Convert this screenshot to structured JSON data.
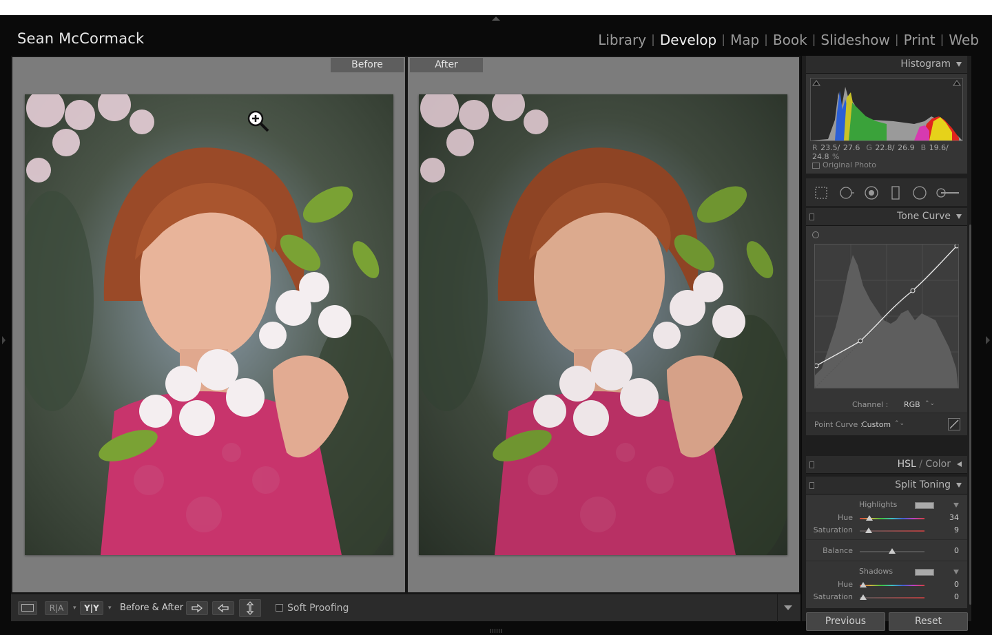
{
  "header": {
    "identity_plate": "Sean McCormack",
    "modules": [
      {
        "label": "Library",
        "active": false
      },
      {
        "label": "Develop",
        "active": true
      },
      {
        "label": "Map",
        "active": false
      },
      {
        "label": "Book",
        "active": false
      },
      {
        "label": "Slideshow",
        "active": false
      },
      {
        "label": "Print",
        "active": false
      },
      {
        "label": "Web",
        "active": false
      }
    ],
    "separator": "|"
  },
  "viewer": {
    "before_label": "Before",
    "after_label": "After",
    "photo_subject": "portrait-red-haired-woman-cherry-blossoms",
    "zoom_cursor_icon": "zoom-in-icon"
  },
  "toolbar": {
    "ra_label": "R|A",
    "yy_label": "Y|Y",
    "caret": "▾",
    "before_after_label": "Before & After :",
    "soft_proofing_label": "Soft Proofing",
    "soft_proofing_checked": false
  },
  "panel": {
    "histogram": {
      "title": "Histogram",
      "readout": {
        "r_label": "R",
        "r_value": "23.5/ 27.6",
        "g_label": "G",
        "g_value": "22.8/ 26.9",
        "b_label": "B",
        "b_value": "19.6/ 24.8",
        "unit": "%"
      },
      "original_photo_label": "Original Photo"
    },
    "tools": [
      "crop-overlay-icon",
      "spot-removal-icon",
      "red-eye-icon",
      "graduated-filter-icon",
      "radial-filter-icon",
      "adjustment-brush-icon"
    ],
    "tone_curve": {
      "title": "Tone Curve",
      "channel_label": "Channel :",
      "channel_value": "RGB",
      "point_curve_label": "Point Curve :",
      "point_curve_value": "Custom",
      "spinner": "⌃⌄"
    },
    "hsl": {
      "title_main": "HSL",
      "title_sep": " / ",
      "title_second": "Color"
    },
    "split_toning": {
      "title": "Split Toning",
      "highlights_label": "Highlights",
      "highlights_hue_label": "Hue",
      "highlights_hue": 34,
      "highlights_saturation_label": "Saturation",
      "highlights_saturation": 9,
      "balance_label": "Balance",
      "balance": 0,
      "shadows_label": "Shadows",
      "shadows_hue_label": "Hue",
      "shadows_hue": 0,
      "shadows_saturation_label": "Saturation",
      "shadows_saturation": 0
    },
    "buttons": {
      "previous": "Previous",
      "reset": "Reset"
    }
  },
  "colors": {
    "background": "#0a0a0a",
    "pane_gray": "#7c7c7c",
    "active_module": "#f0f0f0",
    "inactive_module": "#9a9a9a"
  }
}
